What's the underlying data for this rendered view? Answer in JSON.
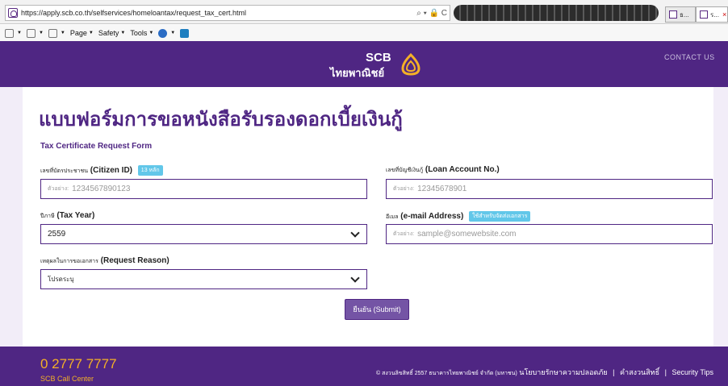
{
  "browser": {
    "url": "https://apply.scb.co.th/selfservices/homeloantax/request_tax_cert.html",
    "addr_controls": "⌕ ▾ 🔒 C",
    "tabs": [
      {
        "label": "ธ..."
      },
      {
        "label": "ร..."
      }
    ]
  },
  "toolbar": {
    "page": "Page",
    "safety": "Safety",
    "tools": "Tools"
  },
  "header": {
    "logo_text": "SCB",
    "logo_thai": "ไทยพาณิชย์",
    "contact": "CONTACT US",
    "brand_color": "#4f2683",
    "accent_color": "#f4b027"
  },
  "form": {
    "title_th": "แบบฟอร์มการขอหนังสือรับรองดอกเบี้ยเงินกู้",
    "title_en": "Tax Certificate Request Form",
    "citizen": {
      "label_th": "เลขที่บัตรประชาชน",
      "label_en": "(Citizen ID)",
      "badge": "13 หลัก",
      "hint": "ตัวอย่าง:",
      "placeholder": "1234567890123"
    },
    "loan": {
      "label_th": "เลขที่บัญชีเงินกู้",
      "label_en": "(Loan Account No.)",
      "hint": "ตัวอย่าง:",
      "placeholder": "12345678901"
    },
    "year": {
      "label_th": "ปีภาษี",
      "label_en": "(Tax Year)",
      "value": "2559"
    },
    "email": {
      "label_th": "อีเมล",
      "label_en": "(e-mail Address)",
      "badge": "ใช้สำหรับจัดส่งเอกสาร",
      "hint": "ตัวอย่าง:",
      "placeholder": "sample@somewebsite.com"
    },
    "reason": {
      "label_th": "เหตุผลในการขอเอกสาร",
      "label_en": "(Request Reason)",
      "value": "โปรดระบุ"
    },
    "submit": "ยืนยัน (Submit)"
  },
  "footer": {
    "phone": "0 2777 7777",
    "call_center": "SCB Call Center",
    "copyright_th": "© สงวนลิขสิทธิ์ 2557 ธนาคารไทยพาณิชย์ จำกัด (มหาชน)",
    "privacy": "นโยบายรักษาความปลอดภัย",
    "terms": "คำสงวนสิทธิ์",
    "security": "Security Tips"
  }
}
